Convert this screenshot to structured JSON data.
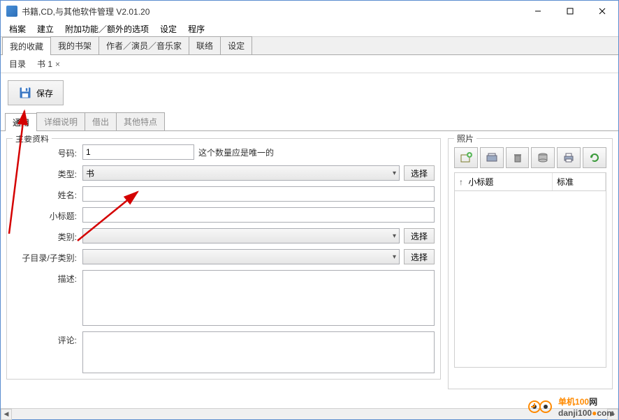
{
  "title": "书籍,CD,与其他软件管理 V2.01.20",
  "menu": {
    "m0": "档案",
    "m1": "建立",
    "m2": "附加功能／额外的选项",
    "m3": "设定",
    "m4": "程序"
  },
  "tabs": {
    "t0": "我的收藏",
    "t1": "我的书架",
    "t2": "作者／演员／音乐家",
    "t3": "联络",
    "t4": "设定"
  },
  "subtabs": {
    "s0": "目录",
    "s1": "书 1"
  },
  "toolbar": {
    "save": "保存"
  },
  "innertabs": {
    "i0": "通用",
    "i1": "详细说明",
    "i2": "借出",
    "i3": "其他特点"
  },
  "group": {
    "main": "主要资料",
    "photo": "照片"
  },
  "labels": {
    "number": "号码:",
    "type": "类型:",
    "name": "姓名:",
    "subtitle": "小标题:",
    "category": "类别:",
    "subcategory": "子目录/子类别:",
    "desc": "描述:",
    "comment": "评论:"
  },
  "values": {
    "number": "1",
    "type": "书"
  },
  "notes": {
    "number_unique": "这个数量应是唯一的"
  },
  "buttons": {
    "select": "选择"
  },
  "photo_cols": {
    "c0": "小标题",
    "c1": "标准"
  },
  "watermark": {
    "brand": "单机100",
    "suffix": "网",
    "domain": "danji100",
    "tld": "com"
  }
}
